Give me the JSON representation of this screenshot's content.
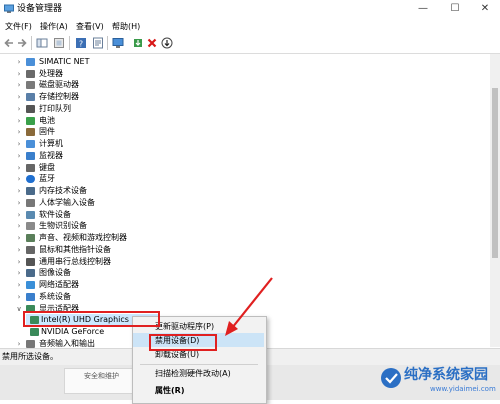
{
  "window": {
    "title": "设备管理器",
    "controls": [
      "—",
      "☐",
      "✕"
    ]
  },
  "menu": [
    "文件(F)",
    "操作(A)",
    "查看(V)",
    "帮助(H)"
  ],
  "tree": {
    "categories": [
      {
        "label": "SIMATIC NET",
        "icon": "network-icon",
        "expanded": false
      },
      {
        "label": "处理器",
        "icon": "processor-icon",
        "expanded": false
      },
      {
        "label": "磁盘驱动器",
        "icon": "disk-drive-icon",
        "expanded": false
      },
      {
        "label": "存储控制器",
        "icon": "storage-controller-icon",
        "expanded": false
      },
      {
        "label": "打印队列",
        "icon": "printer-icon",
        "expanded": false
      },
      {
        "label": "电池",
        "icon": "battery-icon",
        "expanded": false
      },
      {
        "label": "固件",
        "icon": "firmware-icon",
        "expanded": false
      },
      {
        "label": "计算机",
        "icon": "computer-icon",
        "expanded": false
      },
      {
        "label": "监视器",
        "icon": "monitor-icon",
        "expanded": false
      },
      {
        "label": "键盘",
        "icon": "keyboard-icon",
        "expanded": false
      },
      {
        "label": "蓝牙",
        "icon": "bluetooth-icon",
        "expanded": false
      },
      {
        "label": "内存技术设备",
        "icon": "memory-icon",
        "expanded": false
      },
      {
        "label": "人体学输入设备",
        "icon": "hid-icon",
        "expanded": false
      },
      {
        "label": "软件设备",
        "icon": "software-device-icon",
        "expanded": false
      },
      {
        "label": "生物识别设备",
        "icon": "biometric-icon",
        "expanded": false
      },
      {
        "label": "声音、视频和游戏控制器",
        "icon": "sound-icon",
        "expanded": false
      },
      {
        "label": "鼠标和其他指针设备",
        "icon": "mouse-icon",
        "expanded": false
      },
      {
        "label": "通用串行总线控制器",
        "icon": "usb-icon",
        "expanded": false
      },
      {
        "label": "图像设备",
        "icon": "camera-icon",
        "expanded": false
      },
      {
        "label": "网络适配器",
        "icon": "network-adapter-icon",
        "expanded": false
      },
      {
        "label": "系统设备",
        "icon": "system-device-icon",
        "expanded": false
      },
      {
        "label": "显示适配器",
        "icon": "display-adapter-icon",
        "expanded": true
      }
    ],
    "display_children": [
      {
        "label": "Intel(R) UHD Graphics 630",
        "icon": "gpu-icon",
        "selected": true
      },
      {
        "label": "NVIDIA GeForce",
        "icon": "gpu-icon",
        "selected": false
      }
    ],
    "last_category": {
      "label": "音频输入和输出",
      "icon": "audio-io-icon",
      "expanded": false
    }
  },
  "context_menu": {
    "items": [
      {
        "label": "更新驱动程序(P)",
        "bold": false
      },
      {
        "label": "禁用设备(D)",
        "bold": false,
        "highlighted": true
      },
      {
        "label": "卸载设备(U)",
        "bold": false
      },
      {
        "label": "扫描检测硬件改动(A)",
        "bold": false
      },
      {
        "label": "属性(R)",
        "bold": true
      }
    ]
  },
  "status": {
    "text": "禁用所选设备。"
  },
  "background_window": {
    "text": "安全和维护"
  },
  "watermark": {
    "title": "纯净系统家园",
    "url": "www.yidaimei.com"
  },
  "colors": {
    "highlight": "#cce4f7",
    "selection": "#cce8ff",
    "annotation": "#e02020",
    "watermark": "#2b6fc4"
  }
}
